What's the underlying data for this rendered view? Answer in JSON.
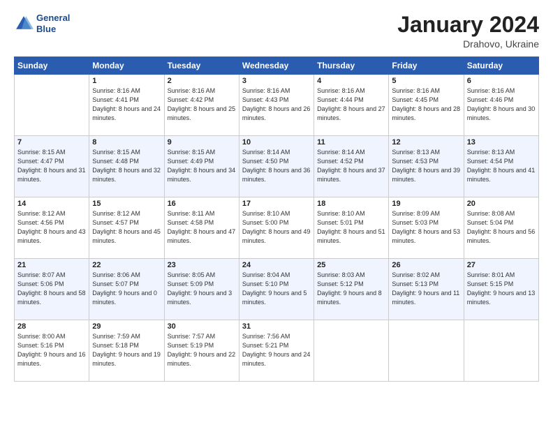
{
  "header": {
    "logo_line1": "General",
    "logo_line2": "Blue",
    "month_title": "January 2024",
    "location": "Drahovo, Ukraine"
  },
  "weekdays": [
    "Sunday",
    "Monday",
    "Tuesday",
    "Wednesday",
    "Thursday",
    "Friday",
    "Saturday"
  ],
  "weeks": [
    [
      {
        "day": "",
        "sunrise": "",
        "sunset": "",
        "daylight": ""
      },
      {
        "day": "1",
        "sunrise": "Sunrise: 8:16 AM",
        "sunset": "Sunset: 4:41 PM",
        "daylight": "Daylight: 8 hours and 24 minutes."
      },
      {
        "day": "2",
        "sunrise": "Sunrise: 8:16 AM",
        "sunset": "Sunset: 4:42 PM",
        "daylight": "Daylight: 8 hours and 25 minutes."
      },
      {
        "day": "3",
        "sunrise": "Sunrise: 8:16 AM",
        "sunset": "Sunset: 4:43 PM",
        "daylight": "Daylight: 8 hours and 26 minutes."
      },
      {
        "day": "4",
        "sunrise": "Sunrise: 8:16 AM",
        "sunset": "Sunset: 4:44 PM",
        "daylight": "Daylight: 8 hours and 27 minutes."
      },
      {
        "day": "5",
        "sunrise": "Sunrise: 8:16 AM",
        "sunset": "Sunset: 4:45 PM",
        "daylight": "Daylight: 8 hours and 28 minutes."
      },
      {
        "day": "6",
        "sunrise": "Sunrise: 8:16 AM",
        "sunset": "Sunset: 4:46 PM",
        "daylight": "Daylight: 8 hours and 30 minutes."
      }
    ],
    [
      {
        "day": "7",
        "sunrise": "Sunrise: 8:15 AM",
        "sunset": "Sunset: 4:47 PM",
        "daylight": "Daylight: 8 hours and 31 minutes."
      },
      {
        "day": "8",
        "sunrise": "Sunrise: 8:15 AM",
        "sunset": "Sunset: 4:48 PM",
        "daylight": "Daylight: 8 hours and 32 minutes."
      },
      {
        "day": "9",
        "sunrise": "Sunrise: 8:15 AM",
        "sunset": "Sunset: 4:49 PM",
        "daylight": "Daylight: 8 hours and 34 minutes."
      },
      {
        "day": "10",
        "sunrise": "Sunrise: 8:14 AM",
        "sunset": "Sunset: 4:50 PM",
        "daylight": "Daylight: 8 hours and 36 minutes."
      },
      {
        "day": "11",
        "sunrise": "Sunrise: 8:14 AM",
        "sunset": "Sunset: 4:52 PM",
        "daylight": "Daylight: 8 hours and 37 minutes."
      },
      {
        "day": "12",
        "sunrise": "Sunrise: 8:13 AM",
        "sunset": "Sunset: 4:53 PM",
        "daylight": "Daylight: 8 hours and 39 minutes."
      },
      {
        "day": "13",
        "sunrise": "Sunrise: 8:13 AM",
        "sunset": "Sunset: 4:54 PM",
        "daylight": "Daylight: 8 hours and 41 minutes."
      }
    ],
    [
      {
        "day": "14",
        "sunrise": "Sunrise: 8:12 AM",
        "sunset": "Sunset: 4:56 PM",
        "daylight": "Daylight: 8 hours and 43 minutes."
      },
      {
        "day": "15",
        "sunrise": "Sunrise: 8:12 AM",
        "sunset": "Sunset: 4:57 PM",
        "daylight": "Daylight: 8 hours and 45 minutes."
      },
      {
        "day": "16",
        "sunrise": "Sunrise: 8:11 AM",
        "sunset": "Sunset: 4:58 PM",
        "daylight": "Daylight: 8 hours and 47 minutes."
      },
      {
        "day": "17",
        "sunrise": "Sunrise: 8:10 AM",
        "sunset": "Sunset: 5:00 PM",
        "daylight": "Daylight: 8 hours and 49 minutes."
      },
      {
        "day": "18",
        "sunrise": "Sunrise: 8:10 AM",
        "sunset": "Sunset: 5:01 PM",
        "daylight": "Daylight: 8 hours and 51 minutes."
      },
      {
        "day": "19",
        "sunrise": "Sunrise: 8:09 AM",
        "sunset": "Sunset: 5:03 PM",
        "daylight": "Daylight: 8 hours and 53 minutes."
      },
      {
        "day": "20",
        "sunrise": "Sunrise: 8:08 AM",
        "sunset": "Sunset: 5:04 PM",
        "daylight": "Daylight: 8 hours and 56 minutes."
      }
    ],
    [
      {
        "day": "21",
        "sunrise": "Sunrise: 8:07 AM",
        "sunset": "Sunset: 5:06 PM",
        "daylight": "Daylight: 8 hours and 58 minutes."
      },
      {
        "day": "22",
        "sunrise": "Sunrise: 8:06 AM",
        "sunset": "Sunset: 5:07 PM",
        "daylight": "Daylight: 9 hours and 0 minutes."
      },
      {
        "day": "23",
        "sunrise": "Sunrise: 8:05 AM",
        "sunset": "Sunset: 5:09 PM",
        "daylight": "Daylight: 9 hours and 3 minutes."
      },
      {
        "day": "24",
        "sunrise": "Sunrise: 8:04 AM",
        "sunset": "Sunset: 5:10 PM",
        "daylight": "Daylight: 9 hours and 5 minutes."
      },
      {
        "day": "25",
        "sunrise": "Sunrise: 8:03 AM",
        "sunset": "Sunset: 5:12 PM",
        "daylight": "Daylight: 9 hours and 8 minutes."
      },
      {
        "day": "26",
        "sunrise": "Sunrise: 8:02 AM",
        "sunset": "Sunset: 5:13 PM",
        "daylight": "Daylight: 9 hours and 11 minutes."
      },
      {
        "day": "27",
        "sunrise": "Sunrise: 8:01 AM",
        "sunset": "Sunset: 5:15 PM",
        "daylight": "Daylight: 9 hours and 13 minutes."
      }
    ],
    [
      {
        "day": "28",
        "sunrise": "Sunrise: 8:00 AM",
        "sunset": "Sunset: 5:16 PM",
        "daylight": "Daylight: 9 hours and 16 minutes."
      },
      {
        "day": "29",
        "sunrise": "Sunrise: 7:59 AM",
        "sunset": "Sunset: 5:18 PM",
        "daylight": "Daylight: 9 hours and 19 minutes."
      },
      {
        "day": "30",
        "sunrise": "Sunrise: 7:57 AM",
        "sunset": "Sunset: 5:19 PM",
        "daylight": "Daylight: 9 hours and 22 minutes."
      },
      {
        "day": "31",
        "sunrise": "Sunrise: 7:56 AM",
        "sunset": "Sunset: 5:21 PM",
        "daylight": "Daylight: 9 hours and 24 minutes."
      },
      {
        "day": "",
        "sunrise": "",
        "sunset": "",
        "daylight": ""
      },
      {
        "day": "",
        "sunrise": "",
        "sunset": "",
        "daylight": ""
      },
      {
        "day": "",
        "sunrise": "",
        "sunset": "",
        "daylight": ""
      }
    ]
  ]
}
